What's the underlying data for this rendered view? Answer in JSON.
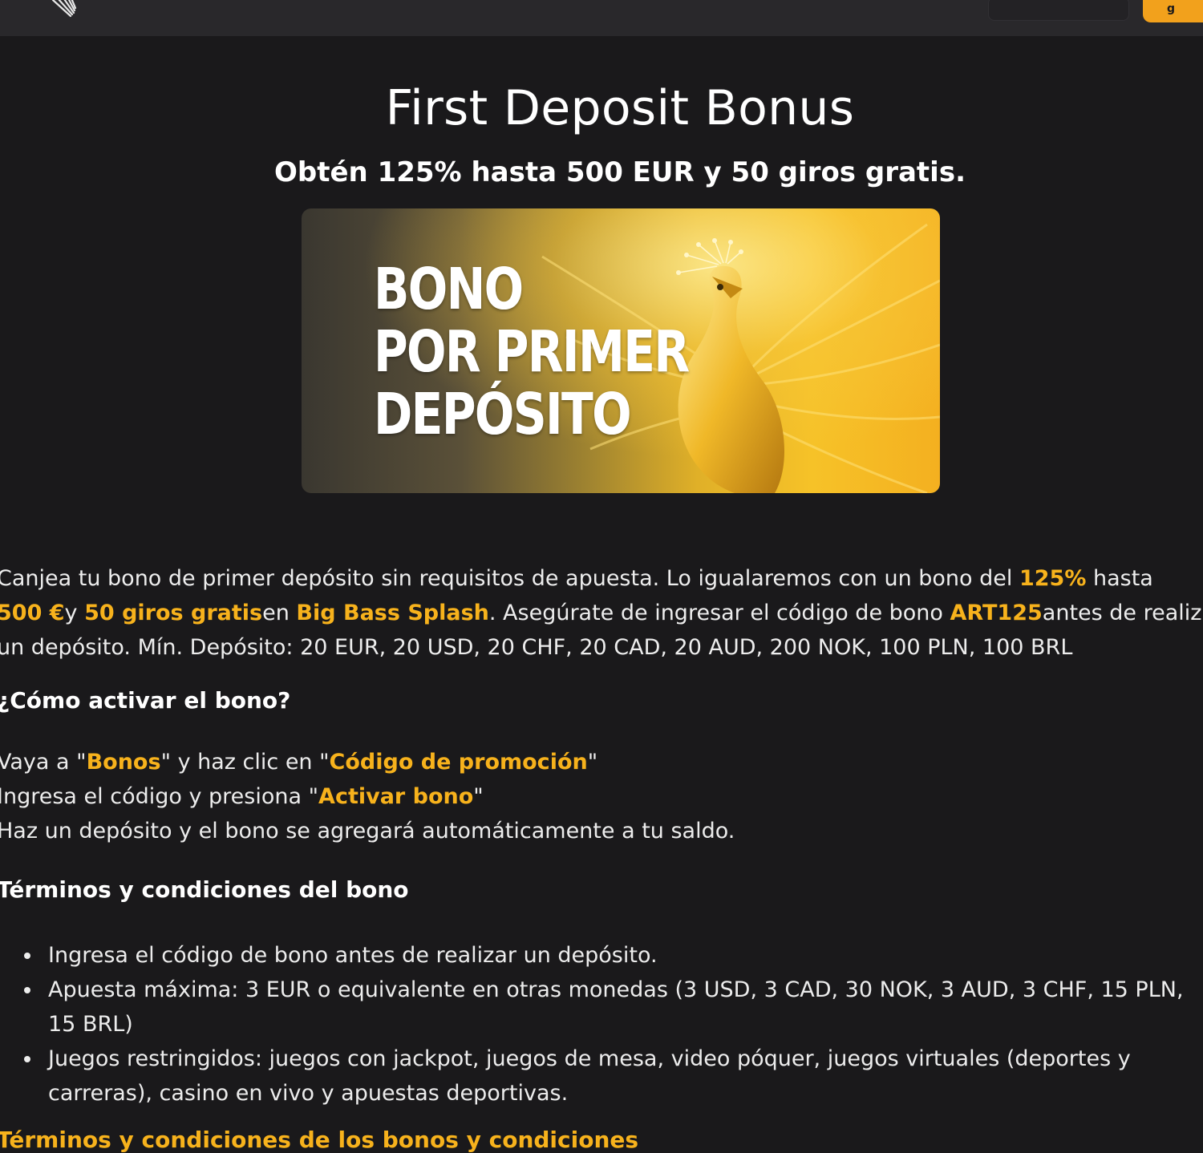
{
  "header": {
    "cta_label": "g"
  },
  "hero": {
    "title": "First Deposit Bonus",
    "subtitle": "Obtén 125% hasta 500 EUR y 50 giros gratis.",
    "banner_lines": [
      "BONO",
      "POR PRIMER",
      "DEPÓSITO"
    ]
  },
  "intro": {
    "line1_a": "Canjea tu bono de primer depósito sin requisitos de apuesta. Lo igualaremos con un bono del ",
    "line1_hl": "125%",
    "line1_b": " hasta",
    "line2_hl1": "500 €",
    "line2_a": "y ",
    "line2_hl2": "50 giros gratis",
    "line2_b": "en ",
    "line2_hl3": "Big Bass Splash",
    "line2_c": ". Asegúrate de ingresar el código de bono ",
    "line2_hl4": "ART125",
    "line2_d": "antes de realizar",
    "line3": "un depósito. Mín. Depósito: 20 EUR, 20 USD, 20 CHF, 20 CAD, 20 AUD, 200 NOK, 100 PLN, 100 BRL"
  },
  "how_to": {
    "heading": "¿Cómo activar el bono?",
    "step1_a": "Vaya a \"",
    "step1_hl1": "Bonos",
    "step1_b": "\" y haz clic en \"",
    "step1_hl2": "Código de promoción",
    "step1_c": "\"",
    "step2_a": "Ingresa el código y presiona \"",
    "step2_hl": "Activar bono",
    "step2_b": "\"",
    "step3": "Haz un depósito y el bono se agregará automáticamente a tu saldo."
  },
  "terms": {
    "heading": "Términos y condiciones del bono",
    "items": [
      "Ingresa el código de bono antes de realizar un depósito.",
      "Apuesta máxima: 3 EUR o equivalente en otras monedas (3 USD, 3 CAD, 30 NOK, 3 AUD, 3 CHF, 15 PLN, 15 BRL)",
      "Juegos restringidos: juegos con jackpot, juegos de mesa, video póquer, juegos virtuales (deportes y carreras), casino en vivo y apuestas deportivas."
    ],
    "more_link": "Términos y condiciones de los bonos y condiciones"
  },
  "colors": {
    "background": "#1a191b",
    "header": "#29282b",
    "accent": "#f7b21c"
  }
}
